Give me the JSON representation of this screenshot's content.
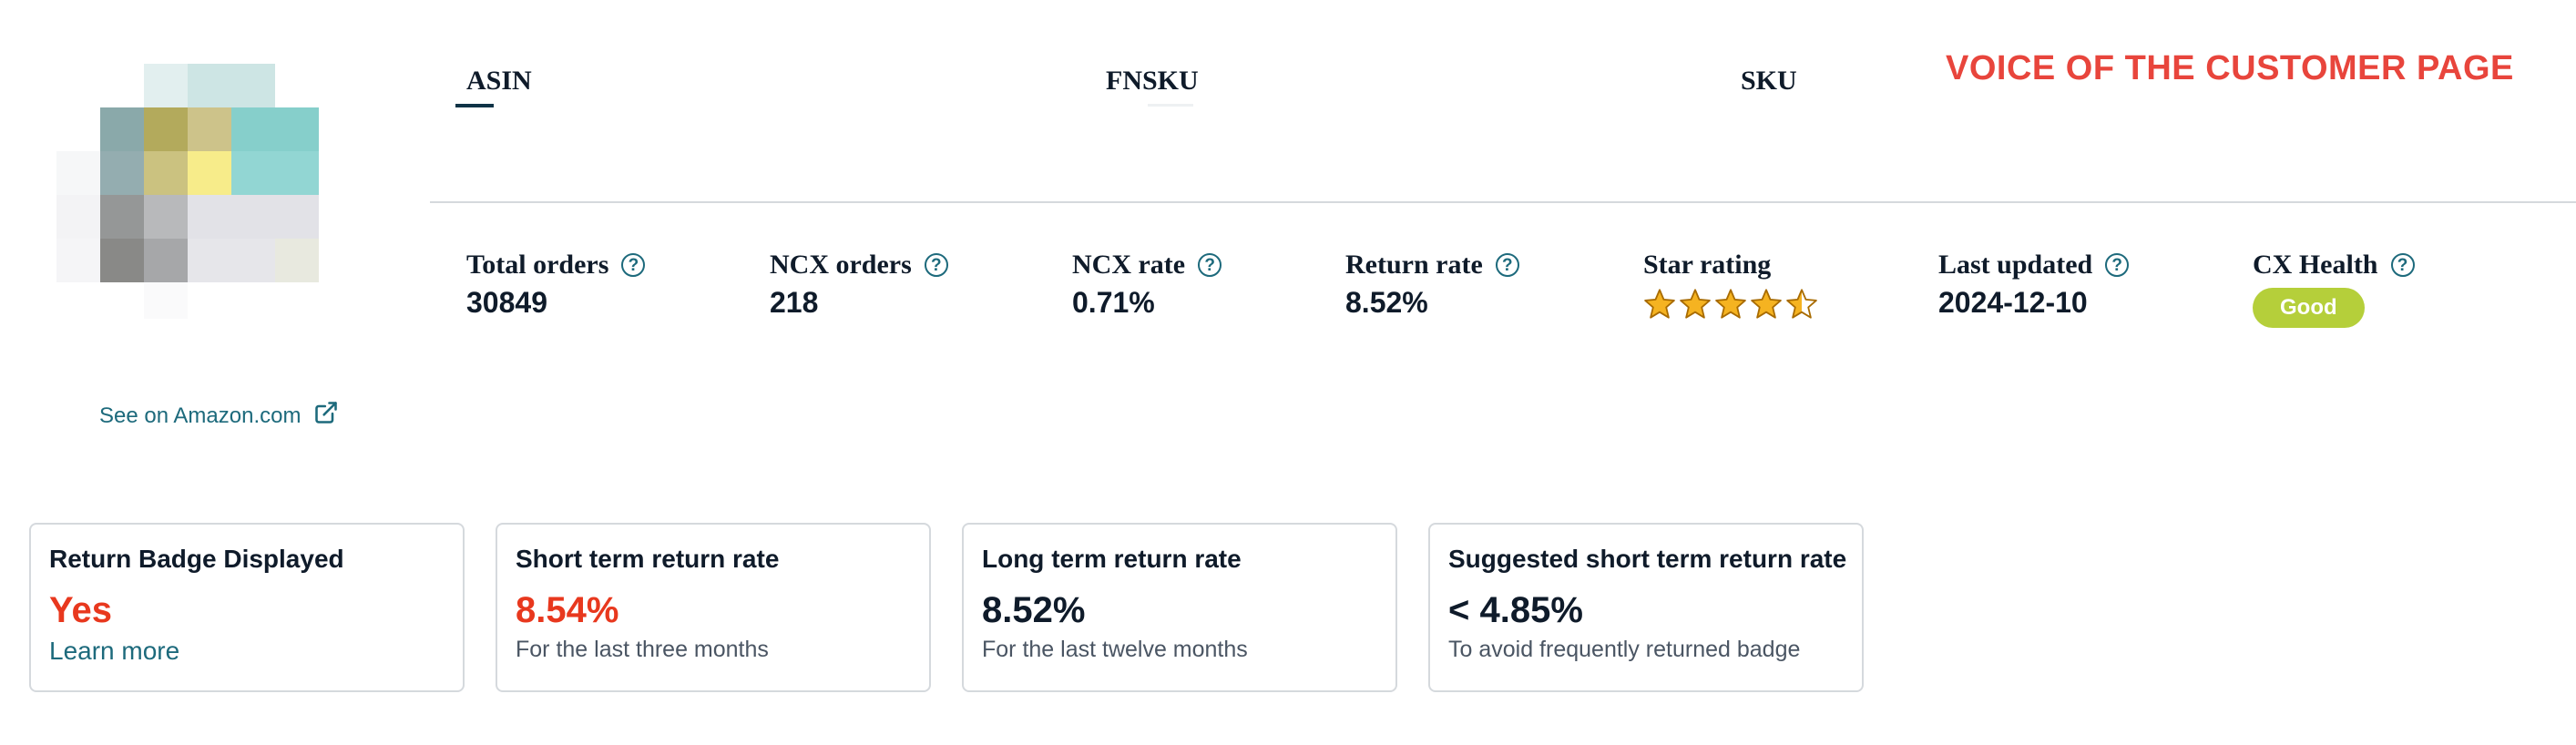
{
  "header": {
    "title": "VOICE OF THE CUSTOMER PAGE",
    "tabs": [
      {
        "label": "ASIN",
        "active": true
      },
      {
        "label": "FNSKU",
        "active": false
      },
      {
        "label": "SKU",
        "active": false
      }
    ]
  },
  "product": {
    "amazon_link_label": "See on Amazon.com",
    "link_icon": "external-link-icon"
  },
  "metrics": [
    {
      "label": "Total orders",
      "value": "30849",
      "help": true
    },
    {
      "label": "NCX orders",
      "value": "218",
      "help": true
    },
    {
      "label": "NCX rate",
      "value": "0.71%",
      "help": true
    },
    {
      "label": "Return rate",
      "value": "8.52%",
      "help": true
    },
    {
      "label": "Star rating",
      "value": "",
      "rating": 4.5,
      "help": false
    },
    {
      "label": "Last updated",
      "value": "2024-12-10",
      "help": true
    },
    {
      "label": "CX Health",
      "value": "Good",
      "help": true
    }
  ],
  "cards": [
    {
      "title": "Return Badge Displayed",
      "value": "Yes",
      "link": "Learn more"
    },
    {
      "title": "Short term return rate",
      "value": "8.54%",
      "sub": "For the last three months"
    },
    {
      "title": "Long term return rate",
      "value": "8.52%",
      "sub": "For the last twelve months"
    },
    {
      "title": "Suggested short term return rate",
      "value": "< 4.85%",
      "sub": "To avoid frequently returned badge"
    }
  ],
  "colors": {
    "accent_red": "#e8453c",
    "link_teal": "#1d6a7c",
    "good_badge": "#b5cf3a",
    "star_gold": "#f5b321"
  }
}
